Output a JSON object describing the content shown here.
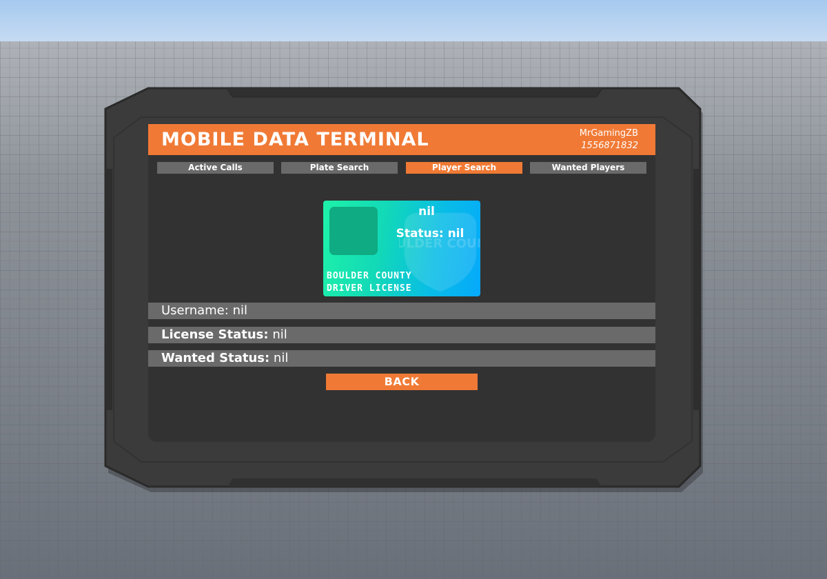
{
  "terminal": {
    "title": "MOBILE DATA TERMINAL",
    "username": "MrGamingZB",
    "user_id": "1556871832"
  },
  "tabs": [
    {
      "label": "Active Calls",
      "active": false
    },
    {
      "label": "Plate Search",
      "active": false
    },
    {
      "label": "Player Search",
      "active": true
    },
    {
      "label": "Wanted Players",
      "active": false
    }
  ],
  "license_card": {
    "name": "nil",
    "status": "Status: nil",
    "county_line1": "BOULDER COUNTY",
    "county_line2": "DRIVER LICENSE",
    "watermark_text": "BOULDER COUNTY"
  },
  "info": {
    "username_label": "Username:",
    "username_value": "nil",
    "license_label": "License Status:",
    "license_value": "nil",
    "wanted_label": "Wanted Status:",
    "wanted_value": "nil"
  },
  "back_button": "BACK",
  "colors": {
    "accent": "#f07a35",
    "panel": "#323232",
    "frame": "#3a3a3a",
    "tab_inactive": "#6a6a6a",
    "card_start": "#1ef2a8",
    "card_end": "#05a9fb"
  }
}
